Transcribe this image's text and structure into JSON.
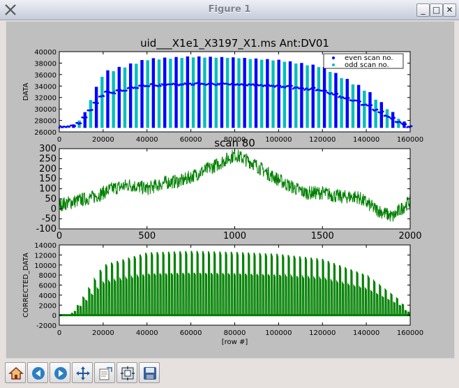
{
  "window": {
    "title": "Figure 1",
    "minimize": "_",
    "maximize": "□",
    "close": "✕"
  },
  "toolbar": {
    "buttons": [
      "home-icon",
      "back-icon",
      "forward-icon",
      "pan-icon",
      "subplots-icon",
      "zoom-icon",
      "save-icon"
    ]
  },
  "colors": {
    "even": "#0000ff",
    "odd": "#00bfbf",
    "green": "#008000"
  },
  "chart_data": [
    {
      "type": "scatter",
      "title": "uid___X1e1_X3197_X1.ms Ant:DV01",
      "xlabel": "",
      "ylabel": "DATA",
      "xlim": [
        0,
        160000
      ],
      "ylim": [
        26000,
        40000
      ],
      "xticks": [
        0,
        20000,
        40000,
        60000,
        80000,
        100000,
        120000,
        140000,
        160000
      ],
      "yticks": [
        26000,
        28000,
        30000,
        32000,
        34000,
        36000,
        38000,
        40000
      ],
      "legend": {
        "placement": "top-right",
        "entries": [
          "even scan no.",
          "odd scan no."
        ]
      },
      "series": [
        {
          "name": "even scan no.",
          "envelope_x": [
            5000,
            10000,
            20000,
            40000,
            60000,
            80000,
            100000,
            120000,
            140000,
            155000,
            160000
          ],
          "envelope_y": [
            27000,
            28000,
            36500,
            38800,
            39200,
            39000,
            38600,
            37500,
            33500,
            28500,
            27000
          ]
        },
        {
          "name": "odd scan no.",
          "envelope_x": [
            5000,
            10000,
            20000,
            40000,
            60000,
            80000,
            100000,
            120000,
            140000,
            155000,
            160000
          ],
          "envelope_y": [
            27000,
            28200,
            36000,
            38500,
            39000,
            38900,
            38400,
            37200,
            33000,
            28200,
            27000
          ]
        }
      ]
    },
    {
      "type": "line",
      "title": "scan 80",
      "xlabel": "",
      "ylabel": "",
      "xlim": [
        0,
        2000
      ],
      "ylim": [
        -100,
        300
      ],
      "xticks": [
        0,
        500,
        1000,
        1500,
        2000
      ],
      "yticks": [
        -100,
        -50,
        0,
        50,
        100,
        150,
        200,
        250,
        300
      ],
      "trend_x": [
        0,
        100,
        200,
        300,
        400,
        500,
        600,
        700,
        800,
        900,
        1000,
        1100,
        1200,
        1300,
        1400,
        1500,
        1600,
        1700,
        1800,
        1900,
        2000
      ],
      "trend_y": [
        20,
        40,
        60,
        100,
        120,
        100,
        130,
        140,
        180,
        220,
        270,
        230,
        170,
        120,
        80,
        80,
        60,
        60,
        0,
        -40,
        40
      ]
    },
    {
      "type": "line",
      "title": "",
      "xlabel": "[row #]",
      "ylabel": "CORRECTED_DATA",
      "xlim": [
        0,
        160000
      ],
      "ylim": [
        -2000,
        14000
      ],
      "xticks": [
        0,
        20000,
        40000,
        60000,
        80000,
        100000,
        120000,
        140000,
        160000
      ],
      "yticks": [
        -2000,
        0,
        2000,
        4000,
        6000,
        8000,
        10000,
        12000,
        14000
      ],
      "envelope_x": [
        5000,
        10000,
        20000,
        40000,
        60000,
        80000,
        100000,
        120000,
        140000,
        155000,
        160000
      ],
      "envelope_y": [
        0,
        3000,
        10000,
        12500,
        12800,
        12600,
        12200,
        11200,
        8000,
        3000,
        0
      ]
    }
  ]
}
